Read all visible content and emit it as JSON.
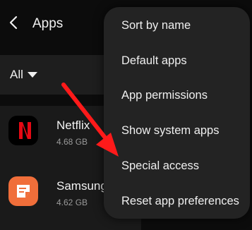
{
  "header": {
    "title": "Apps",
    "back_icon": "back-chevron-icon"
  },
  "filter": {
    "label": "All",
    "caret_icon": "dropdown-caret-icon"
  },
  "apps": [
    {
      "name": "Netflix",
      "size": "4.68 GB",
      "icon": "netflix-icon",
      "icon_color": "#000000",
      "accent": "#e50914"
    },
    {
      "name": "Samsung",
      "size": "4.62 GB",
      "icon": "samsung-notes-icon",
      "icon_color": "#f06e3a"
    }
  ],
  "menu": {
    "items": [
      {
        "label": "Sort by name"
      },
      {
        "label": "Default apps"
      },
      {
        "label": "App permissions"
      },
      {
        "label": "Show system apps"
      },
      {
        "label": "Special access"
      },
      {
        "label": "Reset app preferences"
      }
    ]
  },
  "annotation": {
    "arrow_color": "#ff1a1a",
    "points_to": "Special access"
  }
}
